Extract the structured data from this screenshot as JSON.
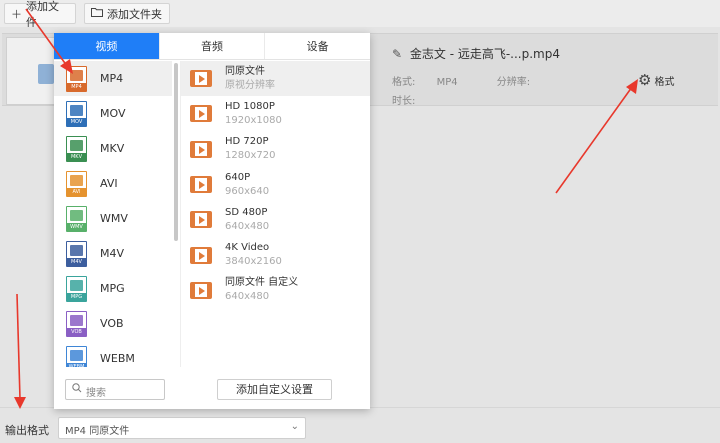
{
  "toolbar": {
    "add_file_label": "添加文件",
    "add_folder_label": "添加文件夹"
  },
  "file": {
    "title": "金志文 - 远走高飞-...p.mp4",
    "format_label": "格式:",
    "format_value": "MP4",
    "resolution_label": "分辨率:",
    "duration_label": "时长:",
    "format_button_label": "格式"
  },
  "popup": {
    "tabs": [
      {
        "label": "视频",
        "active": true
      },
      {
        "label": "音频",
        "active": false
      },
      {
        "label": "设备",
        "active": false
      }
    ],
    "formats": [
      {
        "label": "MP4",
        "color": "#d86a2c"
      },
      {
        "label": "MOV",
        "color": "#2e6fb7"
      },
      {
        "label": "MKV",
        "color": "#3a8f52"
      },
      {
        "label": "AVI",
        "color": "#e5932f"
      },
      {
        "label": "WMV",
        "color": "#58b06a"
      },
      {
        "label": "M4V",
        "color": "#3c5e9e"
      },
      {
        "label": "MPG",
        "color": "#3aa49c"
      },
      {
        "label": "VOB",
        "color": "#8a5fc4"
      },
      {
        "label": "WEBM",
        "color": "#3f86d6"
      }
    ],
    "presets": [
      {
        "name": "同原文件",
        "res": "原视分辨率"
      },
      {
        "name": "HD 1080P",
        "res": "1920x1080"
      },
      {
        "name": "HD 720P",
        "res": "1280x720"
      },
      {
        "name": "640P",
        "res": "960x640"
      },
      {
        "name": "SD 480P",
        "res": "640x480"
      },
      {
        "name": "4K Video",
        "res": "3840x2160"
      },
      {
        "name": "同原文件 自定义",
        "res": "640x480"
      }
    ],
    "search_placeholder": "搜索",
    "add_custom_label": "添加自定义设置"
  },
  "bottom": {
    "output_label": "输出格式",
    "output_value": "MP4  同原文件"
  },
  "colors": {
    "accent": "#1f7ef7",
    "preset_icon": "#e07b3a",
    "arrow": "#e8382c"
  }
}
